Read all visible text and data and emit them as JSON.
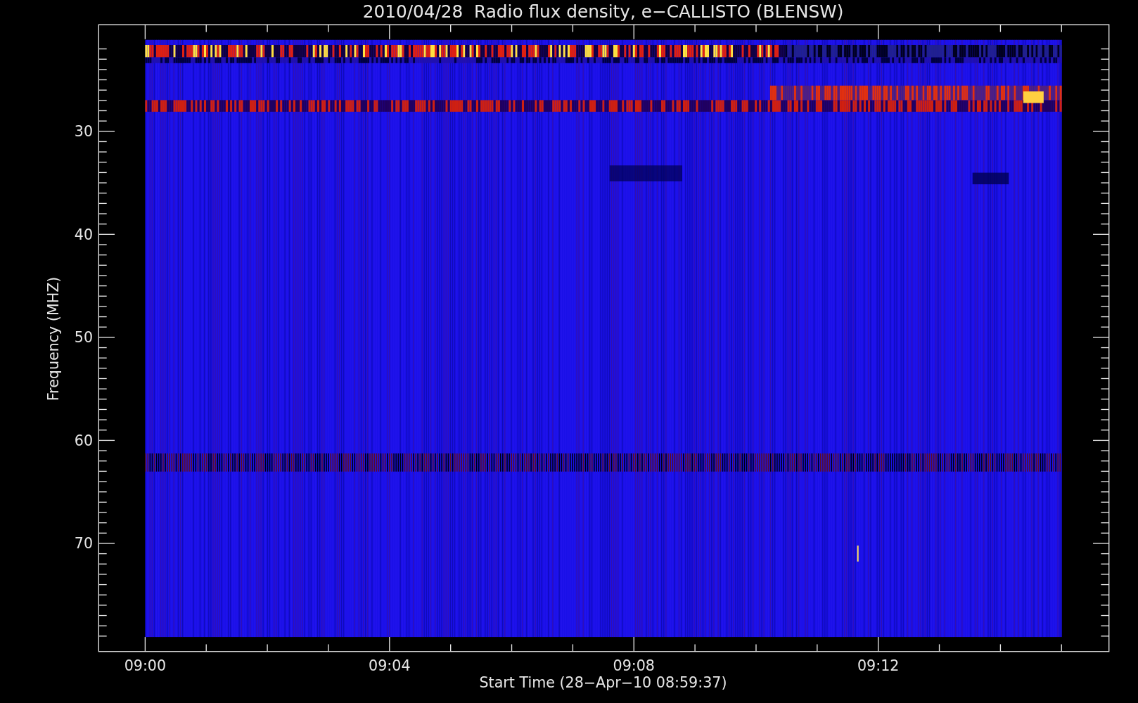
{
  "title": "2010/04/28  Radio flux density, e−CALLISTO (BLENSW)",
  "xlabel": "Start Time (28−Apr−10 08:59:37)",
  "ylabel": "Frequency (MHZ)",
  "xtick_labels": [
    "09:00",
    "09:04",
    "09:08",
    "09:12"
  ],
  "ytick_labels": [
    "30",
    "40",
    "50",
    "60",
    "70"
  ]
}
